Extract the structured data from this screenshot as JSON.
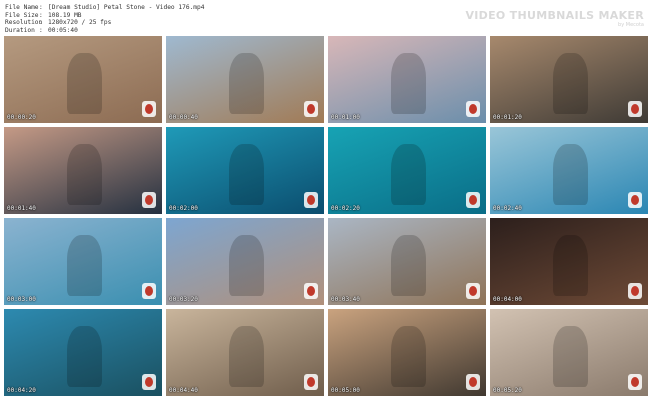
{
  "file_info": [
    {
      "label": "File Name",
      "value": "[Dream Studio] Petal Stone - Video 176.mp4"
    },
    {
      "label": "File Size",
      "value": "108.19 MB"
    },
    {
      "label": "Resolution",
      "value": "1280x720 / 25 fps"
    },
    {
      "label": "Duration",
      "value": "00:05:40"
    }
  ],
  "branding": {
    "title": "VIDEO THUMBNAILS MAKER",
    "subtitle": "by Mecota"
  },
  "thumbnails": [
    {
      "time": "00:00:20",
      "colors": [
        "#b59a80",
        "#8c6b52"
      ]
    },
    {
      "time": "00:00:40",
      "colors": [
        "#9fb9d0",
        "#a17a54"
      ]
    },
    {
      "time": "00:01:00",
      "colors": [
        "#d8b7b8",
        "#6a8eab"
      ]
    },
    {
      "time": "00:01:20",
      "colors": [
        "#a7896d",
        "#3e3a35"
      ]
    },
    {
      "time": "00:01:40",
      "colors": [
        "#c59a86",
        "#243040"
      ]
    },
    {
      "time": "00:02:00",
      "colors": [
        "#1f9ab8",
        "#0b4d6e"
      ]
    },
    {
      "time": "00:02:20",
      "colors": [
        "#17a3b4",
        "#0a6d87"
      ]
    },
    {
      "time": "00:02:40",
      "colors": [
        "#9ac6d8",
        "#2a86b3"
      ]
    },
    {
      "time": "00:03:00",
      "colors": [
        "#8bb3d0",
        "#3a8fb0"
      ]
    },
    {
      "time": "00:03:20",
      "colors": [
        "#7da6d1",
        "#b1907a"
      ]
    },
    {
      "time": "00:03:40",
      "colors": [
        "#aab6c4",
        "#8f7357"
      ]
    },
    {
      "time": "00:04:00",
      "colors": [
        "#2c1f1c",
        "#6e4a36"
      ]
    },
    {
      "time": "00:04:20",
      "colors": [
        "#2d8ab0",
        "#1a5060"
      ]
    },
    {
      "time": "00:04:40",
      "colors": [
        "#c9b59c",
        "#6f5d4b"
      ]
    },
    {
      "time": "00:05:00",
      "colors": [
        "#caa37f",
        "#403830"
      ]
    },
    {
      "time": "00:05:20",
      "colors": [
        "#d2c2b2",
        "#8a7a6c"
      ]
    }
  ]
}
